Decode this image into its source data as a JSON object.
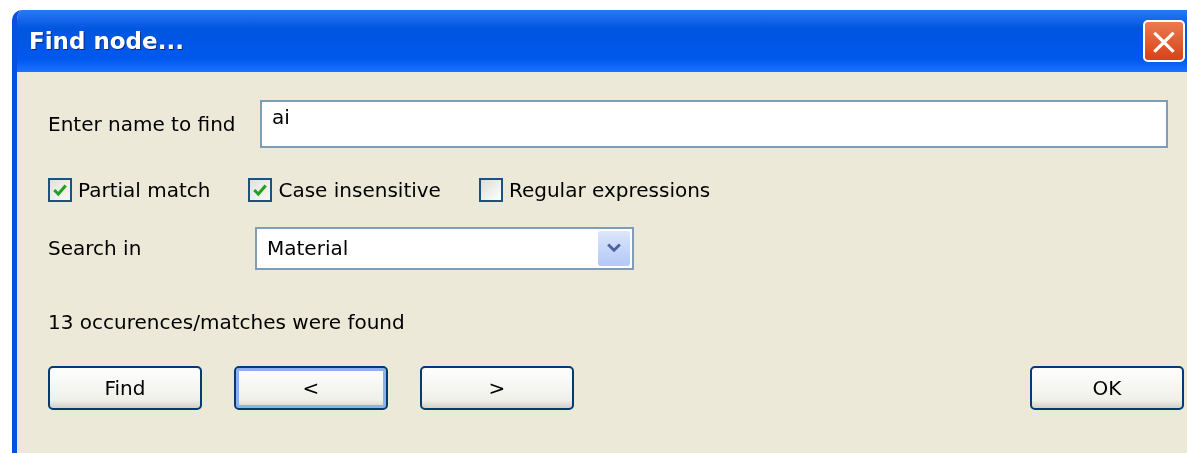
{
  "window": {
    "title": "Find node...",
    "close": "×"
  },
  "name_field": {
    "label": "Enter name to find",
    "value": "ai"
  },
  "options": [
    {
      "label": "Partial match",
      "checked": true
    },
    {
      "label": "Case insensitive",
      "checked": true
    },
    {
      "label": "Regular expressions",
      "checked": false
    }
  ],
  "search_in": {
    "label": "Search in",
    "value": "Material"
  },
  "status": "13 occurences/matches were found",
  "buttons": [
    {
      "label": "Find",
      "focused": false
    },
    {
      "label": "<",
      "focused": true
    },
    {
      "label": ">",
      "focused": false
    },
    {
      "label": "OK",
      "focused": false
    }
  ]
}
